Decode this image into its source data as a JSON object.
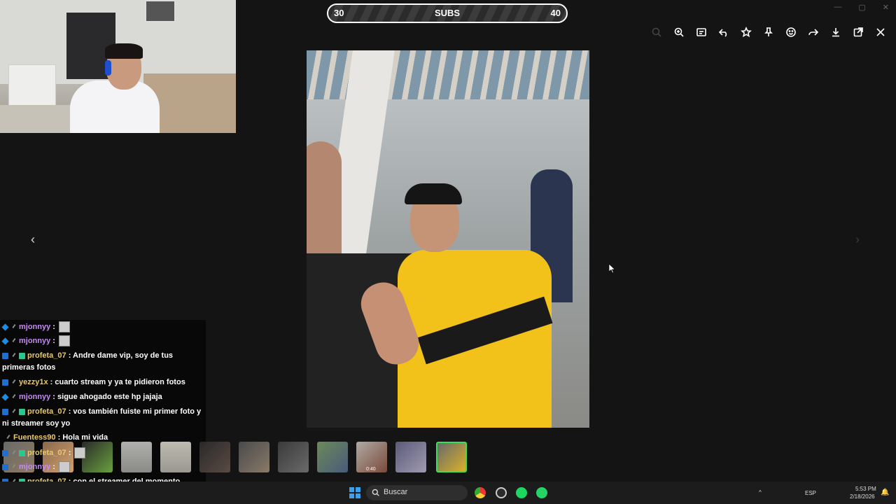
{
  "subs_bar": {
    "left_value": "30",
    "label": "SUBS",
    "right_value": "40"
  },
  "toolbar": {
    "icons": [
      "search-icon",
      "zoom-in-icon",
      "caption-icon",
      "undo-icon",
      "star-icon",
      "pin-icon",
      "emoji-icon",
      "share-icon",
      "download-icon",
      "open-external-icon",
      "close-icon"
    ]
  },
  "nav": {
    "prev": "‹",
    "next": "›"
  },
  "chat": {
    "messages": [
      {
        "user": "mjonnyy",
        "text": "",
        "has_avatar": true
      },
      {
        "user": "mjonnyy",
        "text": "",
        "has_avatar": true
      },
      {
        "user": "profeta_07",
        "text": "Andre dame vip, soy de tus primeras fotos"
      },
      {
        "user": "yezzy1x",
        "text": "cuarto stream y ya te pidieron fotos"
      },
      {
        "user": "mjonnyy",
        "text": "sigue ahogado este hp jajaja"
      },
      {
        "user": "profeta_07",
        "text": "vos también fuiste mi primer foto y ni streamer soy yo"
      },
      {
        "user": "Fuentess90",
        "text": "Hola mi vida"
      },
      {
        "user": "profeta_07",
        "text": "",
        "has_avatar": true
      },
      {
        "user": "mjonnyy",
        "text": "",
        "has_avatar": true
      },
      {
        "user": "profeta_07",
        "text": "con el streamer del momento"
      }
    ],
    "colors": {
      "mjonnyy": "#c58bf2",
      "profeta_07": "#e8c96a",
      "yezzy1x": "#e8c96a",
      "Fuentess90": "#e8c96a"
    }
  },
  "thumbnails": {
    "video_duration": "0:40",
    "selected_index": 11
  },
  "taskbar": {
    "search_placeholder": "Buscar",
    "language": "ESP",
    "time": "5:53 PM",
    "date": "2/18/2026"
  }
}
